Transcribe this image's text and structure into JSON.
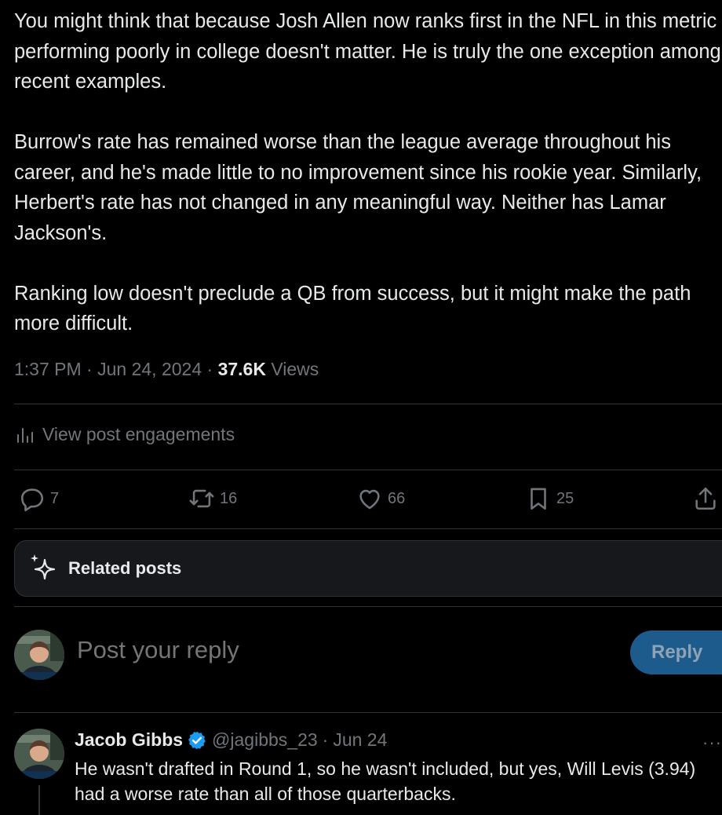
{
  "post": {
    "paragraphs": [
      "You might think that because Josh Allen now ranks first in the NFL in this metric performing poorly in college doesn't matter. He is truly the one exception among recent examples.",
      "Burrow's rate has remained worse than the league average throughout his career, and he's made little to no improvement since his rookie year. Similarly, Herbert's rate has not changed in any meaningful way. Neither has Lamar Jackson's.",
      "Ranking low doesn't preclude a QB from success, but it might make the path more difficult."
    ],
    "time": "1:37 PM",
    "date": "Jun 24, 2024",
    "views_count": "37.6K",
    "views_label": "Views"
  },
  "engagements": {
    "label": "View post engagements",
    "icon": "bar-chart-icon"
  },
  "actions": {
    "replies": "7",
    "reposts": "16",
    "likes": "66",
    "bookmarks": "25"
  },
  "related": {
    "label": "Related posts",
    "icon": "sparkle-icon"
  },
  "composer": {
    "placeholder": "Post your reply",
    "button_label": "Reply"
  },
  "reply": {
    "author_name": "Jacob Gibbs",
    "handle": "@jagibbs_23",
    "separator": "·",
    "date": "Jun 24",
    "text": "He wasn't drafted in Round 1, so he wasn't included, but yes, Will Levis (3.94) had a worse rate than all of those quarterbacks.",
    "more": "···"
  },
  "colors": {
    "background": "#000000",
    "text_primary": "#e7e9ea",
    "text_secondary": "#71767b",
    "accent": "#1d9bf0",
    "reply_button_disabled": "#1d5b8c"
  }
}
